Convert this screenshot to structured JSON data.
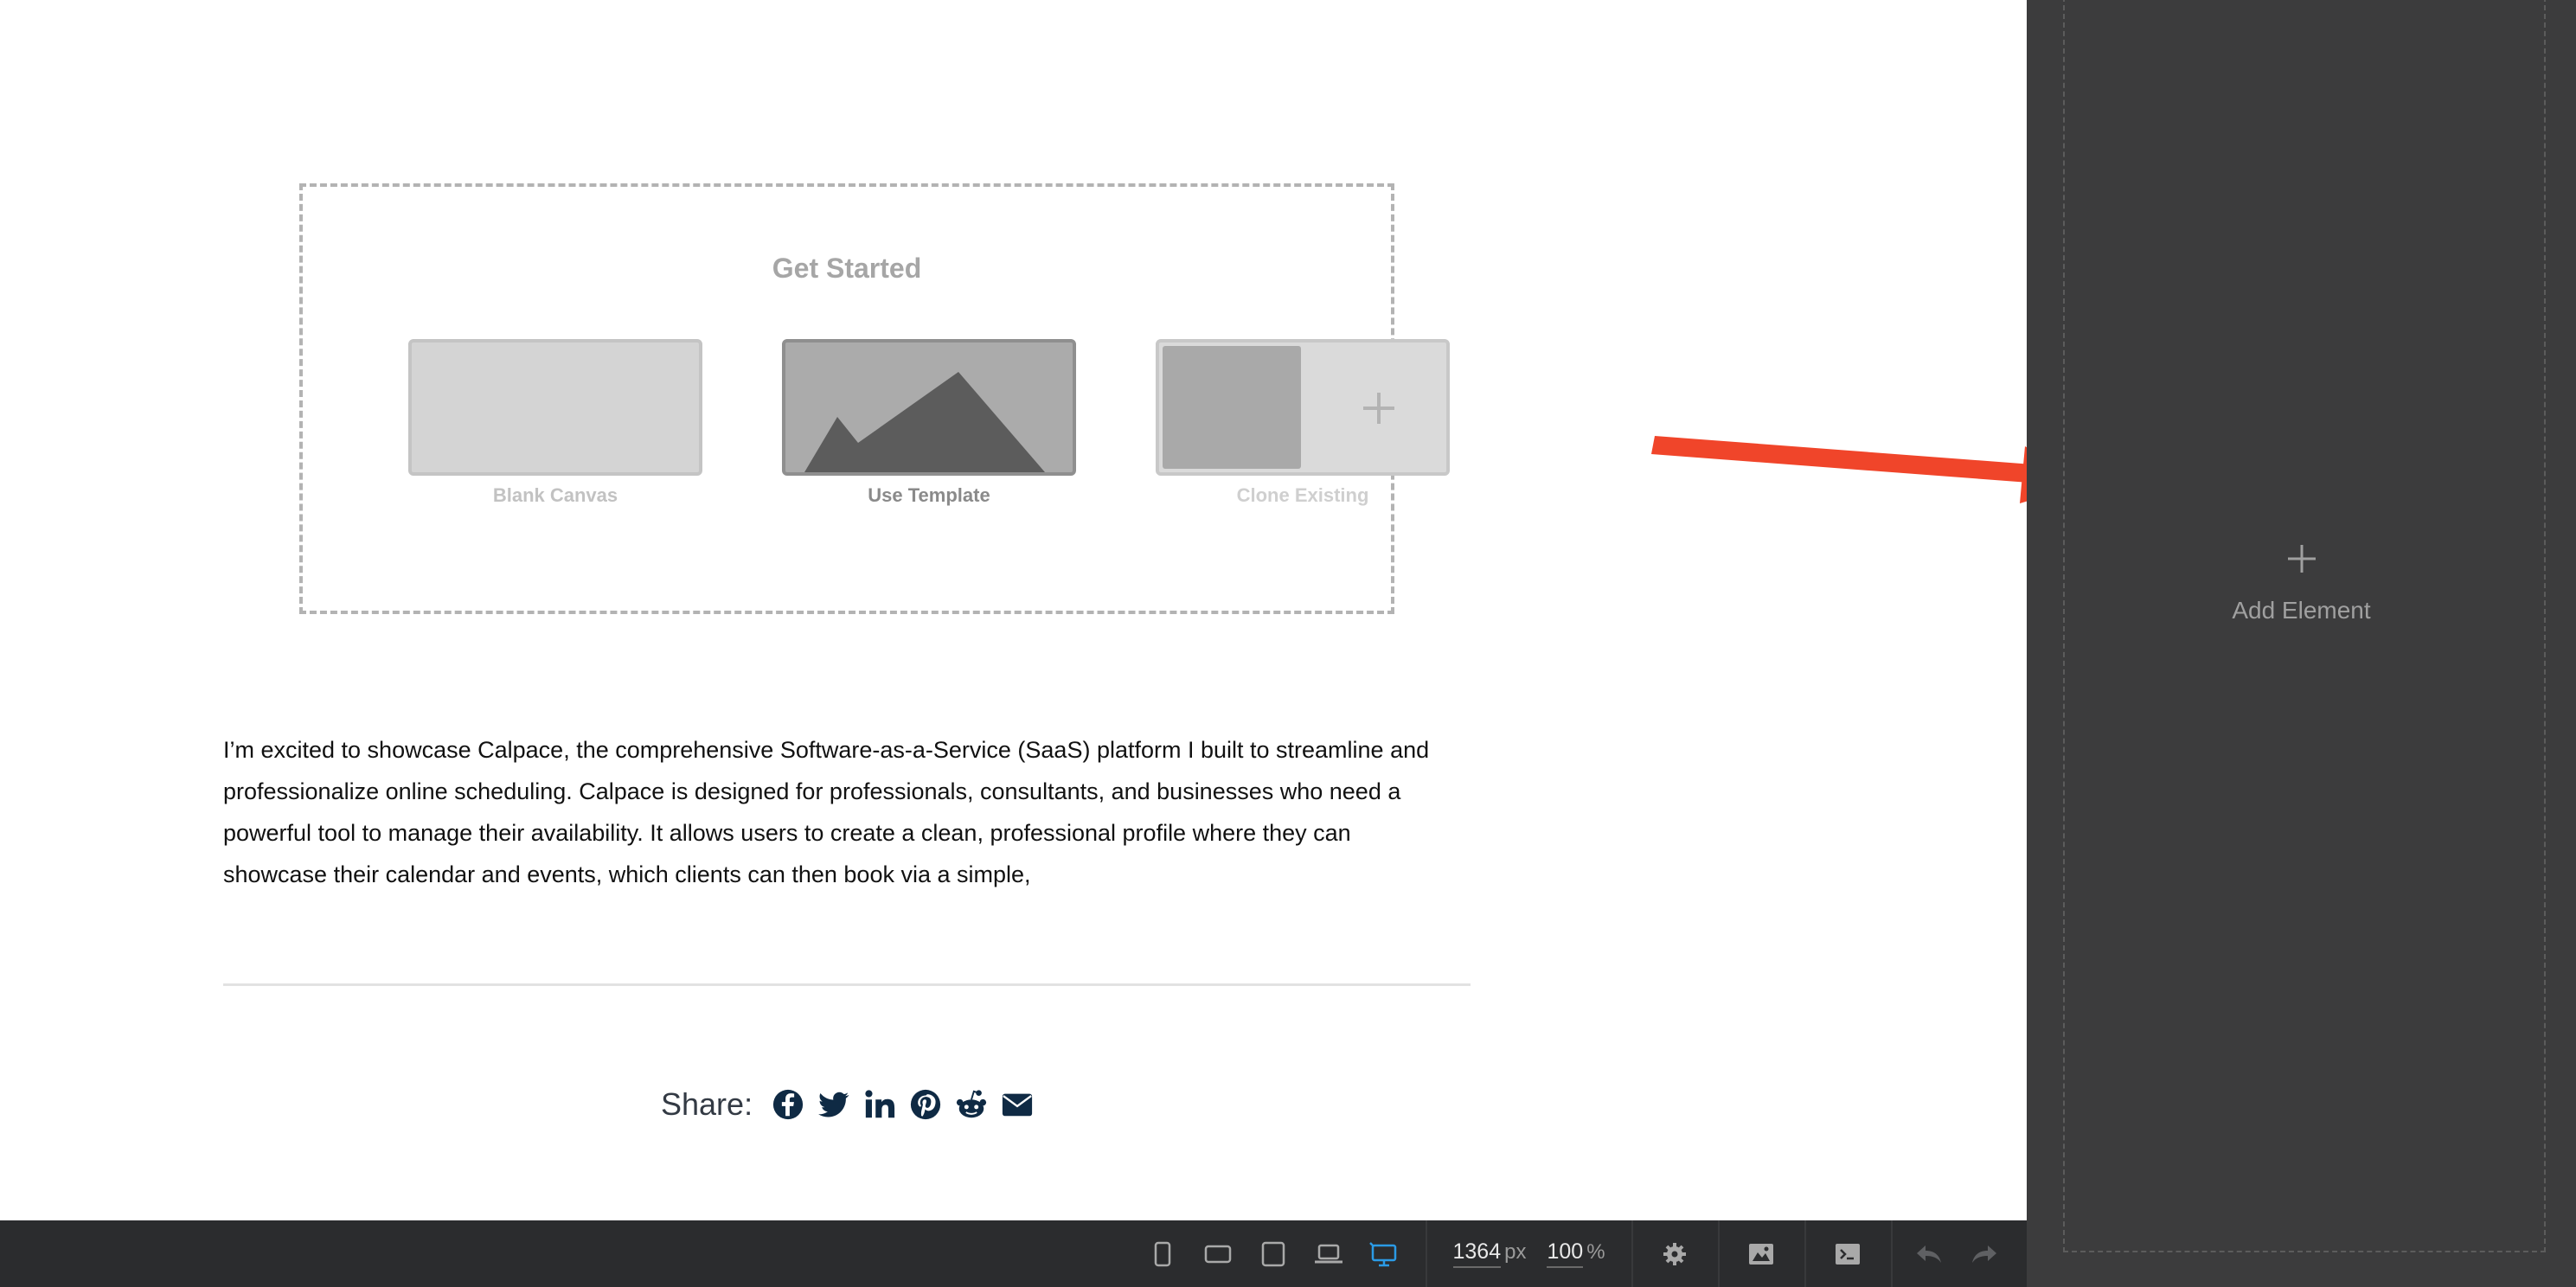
{
  "get_started": {
    "title": "Get Started",
    "options": [
      {
        "label": "Blank Canvas"
      },
      {
        "label": "Use Template"
      },
      {
        "label": "Clone Existing"
      }
    ]
  },
  "article": {
    "paragraph": "I’m excited to showcase Calpace, the comprehensive Software-as-a-Service (SaaS) platform I built to streamline and professionalize online scheduling. Calpace is designed for professionals, consultants, and businesses who need a powerful tool to manage their availability. It allows users to create a clean, professional profile where they can showcase their calendar and events, which clients can then book via a simple,"
  },
  "share": {
    "label": "Share:",
    "icons": [
      "facebook-icon",
      "twitter-icon",
      "linkedin-icon",
      "pinterest-icon",
      "reddit-icon",
      "email-icon"
    ],
    "icon_color": "#0f2a44"
  },
  "sidebar": {
    "add_label": "Add Element",
    "add_icon": "plus-icon"
  },
  "toolbar": {
    "devices": [
      "phone-portrait-icon",
      "phone-landscape-icon",
      "tablet-icon",
      "laptop-icon",
      "desktop-icon"
    ],
    "active_device": "desktop",
    "active_color": "#2b9be6",
    "width_value": "1364",
    "width_unit": "px",
    "zoom_value": "100",
    "zoom_unit": "%",
    "actions": [
      "settings-icon",
      "image-icon",
      "code-icon",
      "undo-icon",
      "redo-icon"
    ]
  },
  "annotation": {
    "color": "#f0452a"
  }
}
